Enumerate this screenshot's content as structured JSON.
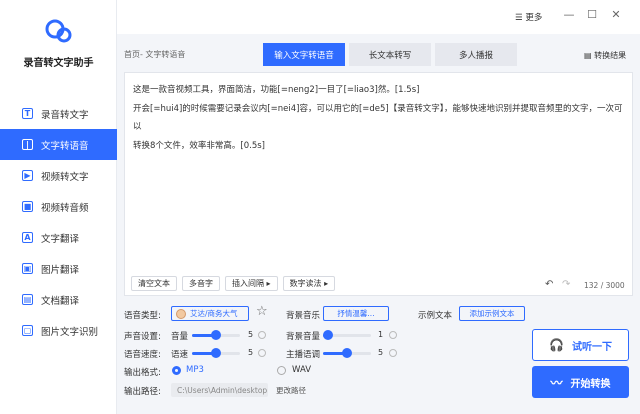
{
  "app": {
    "name": "录音转文字助手"
  },
  "sidebar": {
    "items": [
      {
        "label": "录音转文字",
        "icon": "T"
      },
      {
        "label": "文字转语音",
        "icon": "|"
      },
      {
        "label": "视频转文字",
        "icon": "▶"
      },
      {
        "label": "视频转音频",
        "icon": "■"
      },
      {
        "label": "文字翻译",
        "icon": "A"
      },
      {
        "label": "图片翻译",
        "icon": "▣"
      },
      {
        "label": "文档翻译",
        "icon": "▤"
      },
      {
        "label": "图片文字识别",
        "icon": "▢"
      }
    ],
    "active_index": 1
  },
  "topbar": {
    "more_label": "更多",
    "minimize": "—",
    "maximize": "☐",
    "close": "✕"
  },
  "breadcrumb": "首页- 文字转语音",
  "tabs": [
    "输入文字转语音",
    "长文本转写",
    "多人播报"
  ],
  "export_label": "转换结果",
  "editor": {
    "line1": "这是一款音视频工具，界面简洁，功能[=neng2]一目了[=liao3]然。[1.5s]",
    "line2": "开会[=hui4]的时候需要记录会议内[=nei4]容，可以用它的[=de5]【录音转文字】，能够快速地识别并提取音频里的文字，一次可以",
    "line3": "转换8个文件，效率非常高。[0.5s]",
    "tools": [
      "清空文本",
      "多音字",
      "插入间隔 ▸",
      "数字读法 ▸"
    ],
    "counter": "132 / 3000"
  },
  "settings": {
    "voice_type_label": "语音类型:",
    "voice_name": "艾达/商务大气",
    "bgm_label": "背景音乐",
    "bgm_value": "抒情温馨...",
    "sample_label": "示例文本",
    "sample_button": "添加示例文本",
    "sound_label": "声音设置:",
    "volume_label": "音量",
    "volume_value": "5",
    "volume_fraction": 0.5,
    "bg_volume_label": "背景音量",
    "bg_volume_value": "1",
    "bg_volume_fraction": 0.1,
    "speed_group_label": "语音速度:",
    "speed_label": "语速",
    "speed_value": "5",
    "speed_fraction": 0.5,
    "pitch_label": "主播语调",
    "pitch_value": "5",
    "pitch_fraction": 0.5,
    "format_label": "输出格式:",
    "format_mp3": "MP3",
    "format_wav": "WAV",
    "path_label": "输出路径:",
    "path_value": "C:\\Users\\Admin\\desktop",
    "change_path": "更改路径"
  },
  "actions": {
    "try_label": "试听一下",
    "start_label": "开始转换"
  },
  "colors": {
    "accent": "#2f6bff",
    "sidebar_bg": "#ffffff",
    "page_bg": "#f3f5f9"
  }
}
